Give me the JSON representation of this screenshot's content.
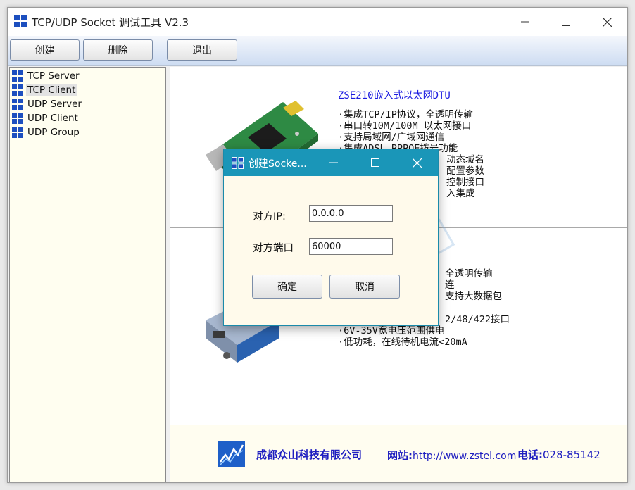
{
  "window": {
    "title": "TCP/UDP Socket 调试工具 V2.3"
  },
  "toolbar": {
    "create_label": "创建",
    "delete_label": "删除",
    "exit_label": "退出"
  },
  "tree": {
    "items": [
      {
        "label": "TCP Server",
        "selected": false
      },
      {
        "label": "TCP Client",
        "selected": true
      },
      {
        "label": "UDP Server",
        "selected": false
      },
      {
        "label": "UDP Client",
        "selected": false
      },
      {
        "label": "UDP Group",
        "selected": false
      }
    ]
  },
  "ad": {
    "product1": {
      "title": "ZSE210嵌入式以太网DTU",
      "features": [
        "·集成TCP/IP协议，全透明传输",
        "·串口转10M/100M 以太网接口",
        "·支持局域网/广域网通信",
        "·集成ADSL PPPOE拨号功能",
        "动态域名",
        "配置参数",
        "控制接口",
        "入集成"
      ]
    },
    "product2": {
      "features": [
        "全透明传输",
        "连",
        "支持大数据包",
        "2/48/422接口",
        "·6V-35V宽电压范围供电",
        "·低功耗，在线待机电流<20mA"
      ]
    },
    "footer": {
      "company": "成都众山科技有限公司",
      "website_label": "网站:",
      "website": "http://www.zstel.com",
      "phone_label": "电话:",
      "phone": "028-85142"
    }
  },
  "dialog": {
    "title": "创建Socke...",
    "ip_label": "对方IP:",
    "ip_value": "0.0.0.0",
    "port_label": "对方端口",
    "port_value": "60000",
    "ok_label": "确定",
    "cancel_label": "取消"
  },
  "colors": {
    "accent": "#1a96b8",
    "link_blue": "#1e1ec0",
    "tree_bg": "#fffef0"
  }
}
